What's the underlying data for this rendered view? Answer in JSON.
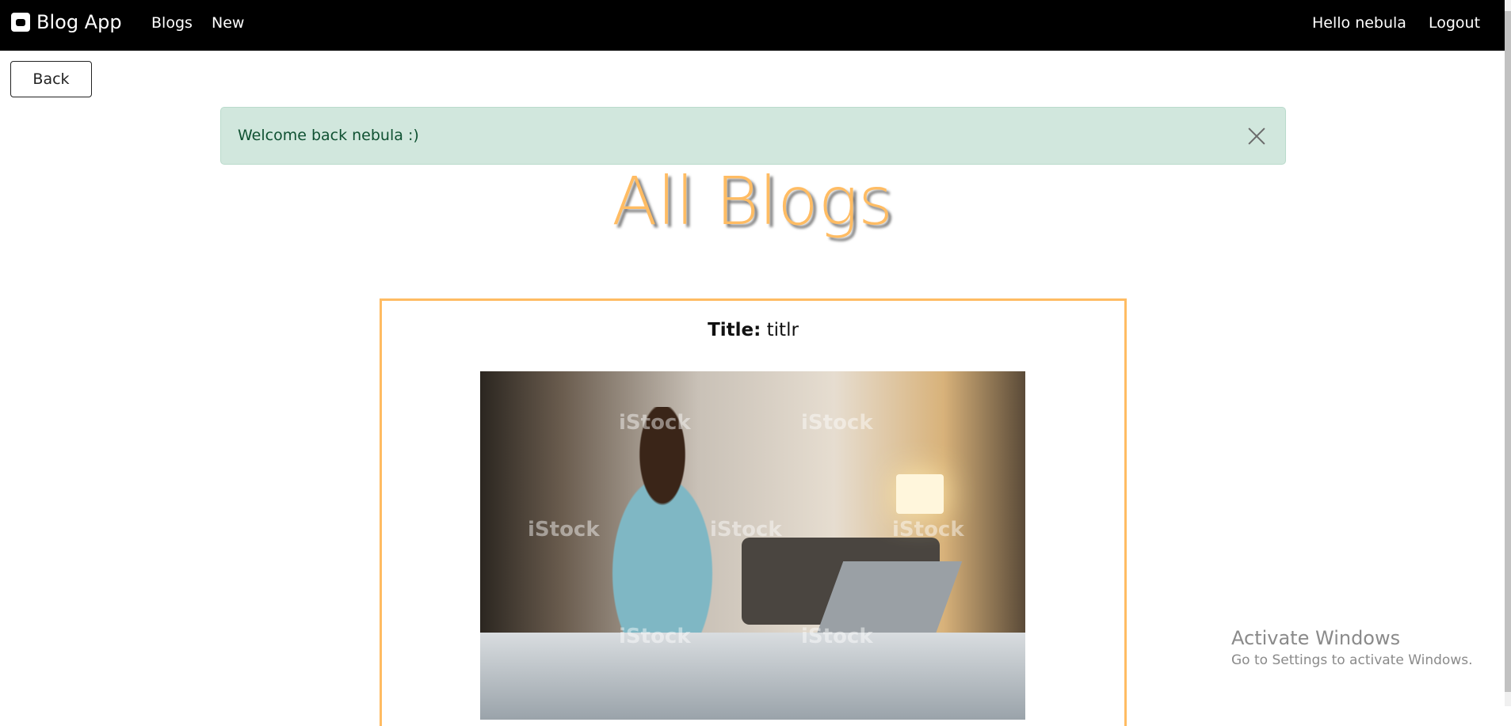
{
  "navbar": {
    "brand": "Blog App",
    "brand_icon": "blogger-icon",
    "links": [
      "Blogs",
      "New"
    ],
    "greeting": "Hello nebula",
    "logout": "Logout"
  },
  "back_label": "Back",
  "alert": {
    "message": "Welcome back nebula :)",
    "close_icon": "close-icon"
  },
  "page_title": "All Blogs",
  "blog": {
    "title_label": "Title:",
    "title_value": "titlr",
    "watermark": "iStock"
  },
  "os_watermark": {
    "line1": "Activate Windows",
    "line2": "Go to Settings to activate Windows."
  },
  "colors": {
    "accent": "#ffbc63",
    "alert_bg": "#d1e7dd",
    "navbar": "#000000"
  }
}
